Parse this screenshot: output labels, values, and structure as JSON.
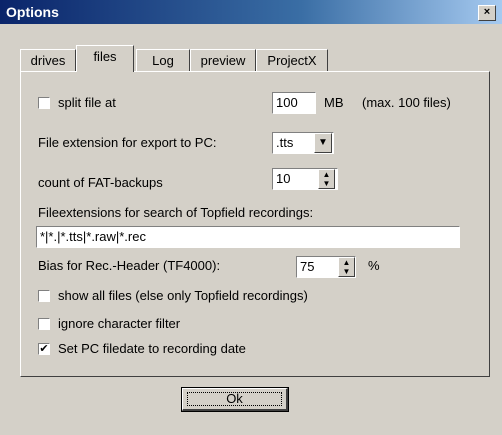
{
  "window": {
    "title": "Options",
    "close_label": "×"
  },
  "tabs": [
    {
      "label": "drives"
    },
    {
      "label": "files"
    },
    {
      "label": "Log"
    },
    {
      "label": "preview"
    },
    {
      "label": "ProjectX"
    }
  ],
  "split": {
    "label": "split file at",
    "checked": false,
    "value": "100",
    "unit": "MB",
    "note": "(max. 100 files)"
  },
  "export_ext": {
    "label": "File extension for export to PC:",
    "value": ".tts"
  },
  "fat_backups": {
    "label": "count of FAT-backups",
    "value": "10"
  },
  "search_ext": {
    "label": "Fileextensions for search of Topfield recordings:",
    "value": "*|*.|*.tts|*.raw|*.rec"
  },
  "bias": {
    "label": "Bias for Rec.-Header (TF4000):",
    "value": "75",
    "unit": "%"
  },
  "show_all": {
    "label": "show all files (else only Topfield recordings)",
    "checked": false,
    "mark": ""
  },
  "ignore_filter": {
    "label": "ignore character filter",
    "checked": false,
    "mark": ""
  },
  "set_date": {
    "label": "Set PC filedate to recording date",
    "checked": true,
    "mark": "✔"
  },
  "ok_label": "Ok",
  "icons": {
    "spin_up": "▲",
    "spin_down": "▼",
    "dropdown": "▼"
  }
}
